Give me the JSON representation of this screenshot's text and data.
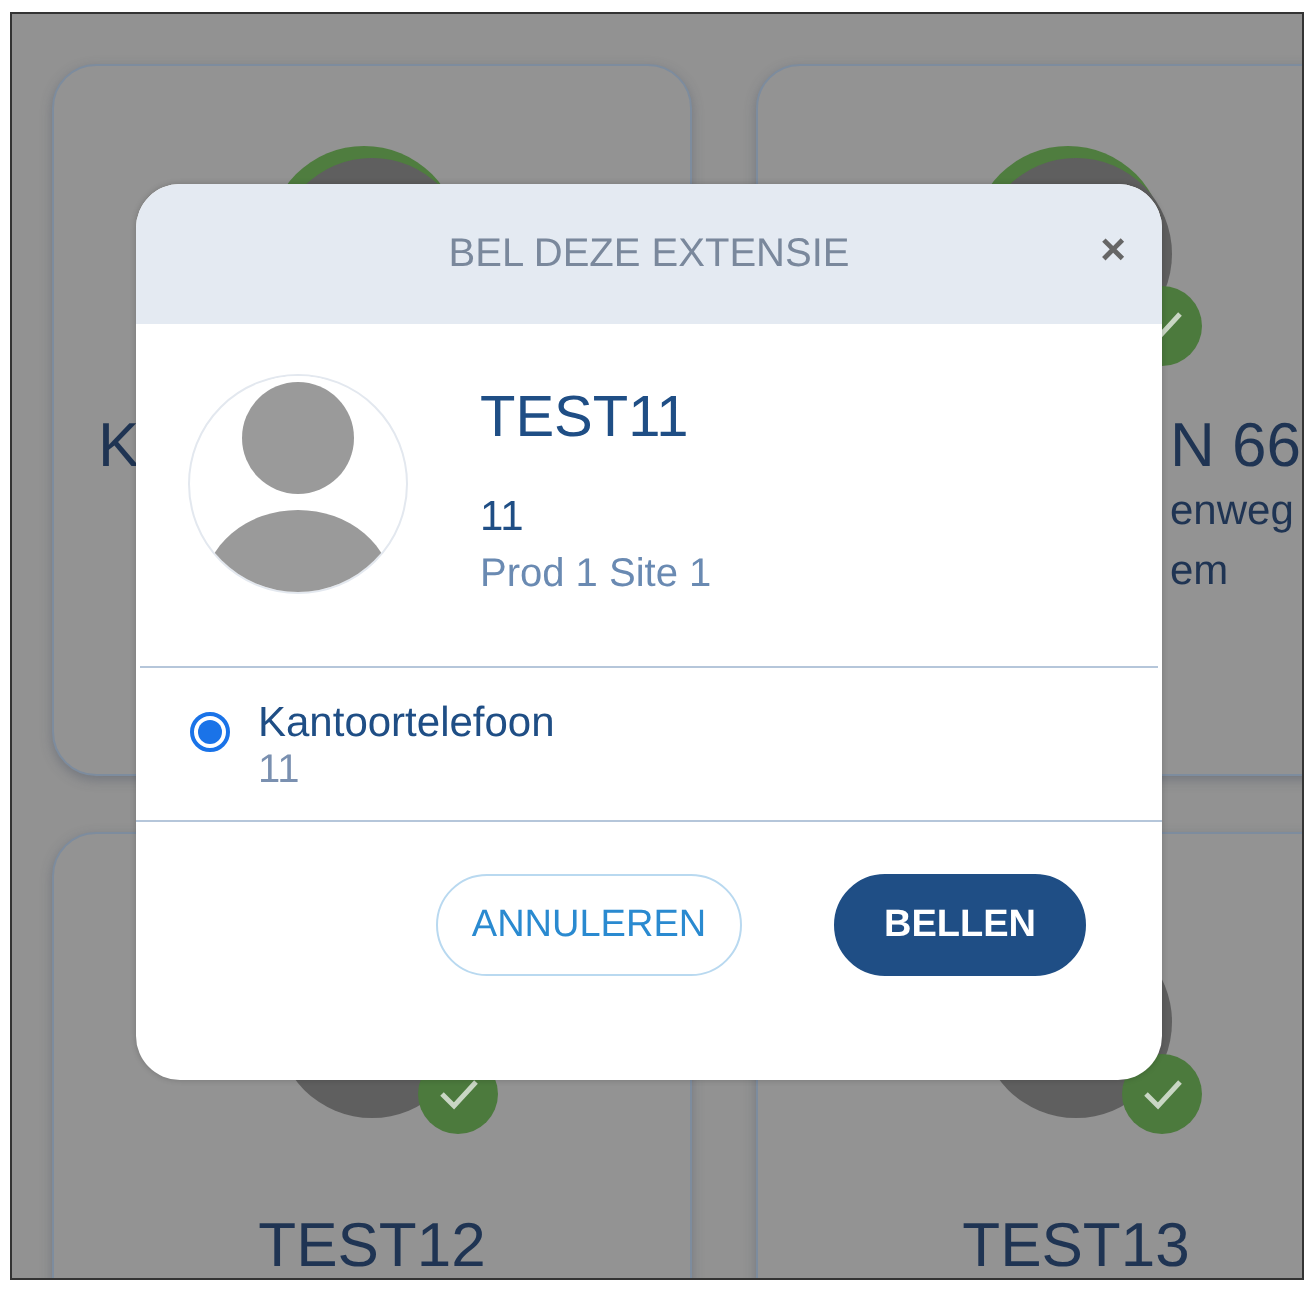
{
  "background_cards": [
    {
      "name": "K"
    },
    {
      "name": "N 66",
      "lines": [
        "enweg",
        "em"
      ],
      "available": true
    },
    {
      "name": "TEST12",
      "available": true
    },
    {
      "name": "TEST13",
      "available": true
    }
  ],
  "dialog": {
    "title": "BEL DEZE EXTENSIE",
    "close": "×",
    "name": "TEST11",
    "extension": "11",
    "location": "Prod 1 Site 1",
    "phones": [
      {
        "label": "Kantoortelefoon",
        "number": "11",
        "selected": true
      }
    ],
    "buttons": [
      {
        "kind": "secondary",
        "label": "ANNULEREN"
      },
      {
        "kind": "primary",
        "label": "BELLEN"
      }
    ]
  }
}
